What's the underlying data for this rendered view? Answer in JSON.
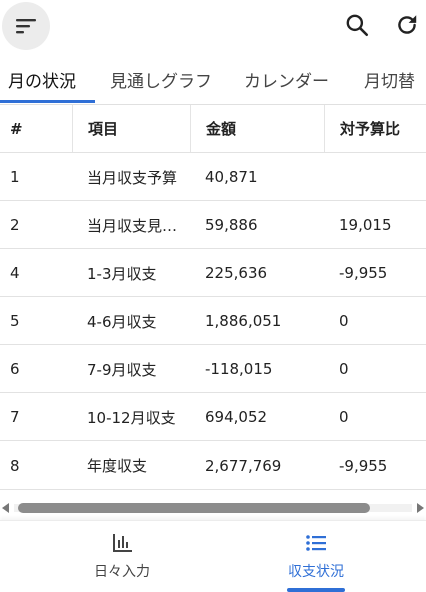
{
  "toolbar": {
    "menu_icon": "sort-menu-icon",
    "search_icon": "search-icon",
    "refresh_icon": "refresh-icon"
  },
  "tabs": [
    {
      "label": "月の状況",
      "active": true
    },
    {
      "label": "見通しグラフ",
      "active": false
    },
    {
      "label": "カレンダー",
      "active": false
    },
    {
      "label": "月切替",
      "active": false
    }
  ],
  "table": {
    "headers": [
      "#",
      "項目",
      "金額",
      "対予算比"
    ],
    "rows": [
      {
        "num": "1",
        "item": "当月収支予算",
        "amount": "40,871",
        "budget": ""
      },
      {
        "num": "2",
        "item": "当月収支見…",
        "amount": "59,886",
        "budget": "19,015"
      },
      {
        "num": "4",
        "item": "1-3月収支",
        "amount": "225,636",
        "budget": "-9,955"
      },
      {
        "num": "5",
        "item": "4-6月収支",
        "amount": "1,886,051",
        "budget": "0"
      },
      {
        "num": "6",
        "item": "7-9月収支",
        "amount": "-118,015",
        "budget": "0"
      },
      {
        "num": "7",
        "item": "10-12月収支",
        "amount": "694,052",
        "budget": "0"
      },
      {
        "num": "8",
        "item": "年度収支",
        "amount": "2,677,769",
        "budget": "-9,955"
      }
    ]
  },
  "bottom_nav": [
    {
      "label": "日々入力",
      "icon": "bar-chart-icon",
      "active": false
    },
    {
      "label": "収支状況",
      "icon": "list-icon",
      "active": true
    }
  ],
  "colors": {
    "accent": "#2f6fd6",
    "menu_bg": "#ececec",
    "divider": "#e2e2e2"
  }
}
